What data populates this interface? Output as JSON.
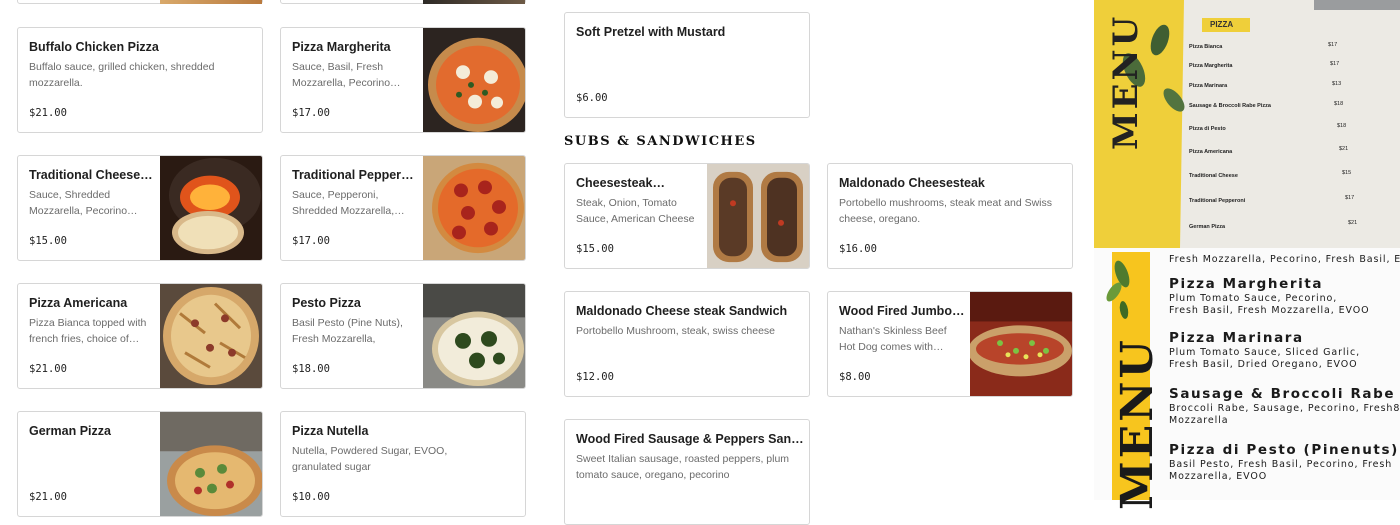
{
  "col1": [
    {
      "name": "Buffalo Chicken Pizza",
      "desc": "Buffalo sauce, grilled chicken, shredded mozzarella.",
      "price": "$21.00"
    },
    {
      "name": "Traditional Cheese…",
      "desc": "Sauce, Shredded Mozzarella, Pecorino…",
      "price": "$15.00"
    },
    {
      "name": "Pizza Americana",
      "desc": "Pizza Bianca topped with french fries, choice of…",
      "price": "$21.00"
    },
    {
      "name": "German Pizza",
      "desc": "",
      "price": "$21.00"
    }
  ],
  "col2": [
    {
      "name": "Pizza Margherita",
      "desc": "Sauce, Basil, Fresh Mozzarella, Pecorino…",
      "price": "$17.00"
    },
    {
      "name": "Traditional Pepperoni…",
      "desc": "Sauce, Pepperoni, Shredded Mozzarella,…",
      "price": "$17.00"
    },
    {
      "name": "Pesto Pizza",
      "desc": "Basil Pesto (Pine Nuts), Fresh Mozzarella, Pecori…",
      "price": "$18.00"
    },
    {
      "name": "Pizza Nutella",
      "desc": "Nutella, Powdered Sugar, EVOO, granulated sugar",
      "price": "$10.00"
    }
  ],
  "pretzel": {
    "name": "Soft Pretzel with Mustard",
    "desc": "",
    "price": "$6.00"
  },
  "section_title": "SUBS & SANDWICHES",
  "subs": [
    {
      "name": "Cheesesteak…",
      "desc": "Steak, Onion, Tomato Sauce, American Cheese",
      "price": "$15.00"
    },
    {
      "name": "Maldonado Cheesesteak",
      "desc": "Portobello mushrooms, steak meat and Swiss cheese, oregano.",
      "price": "$16.00"
    },
    {
      "name": "Maldonado Cheese steak Sandwich",
      "desc": "Portobello Mushroom, steak, swiss cheese",
      "price": "$12.00"
    },
    {
      "name": "Wood Fired Jumbo…",
      "desc": "Nathan's Skinless Beef Hot Dog comes with…",
      "price": "$8.00"
    },
    {
      "name": "Wood Fired Sausage & Peppers Sandwich",
      "desc": "Sweet Italian sausage, roasted peppers, plum tomato sauce, oregano, pecorino",
      "price": ""
    }
  ],
  "photo_menu": {
    "header": "PIZZA",
    "side_word": "MENU",
    "items": [
      {
        "name": "Pizza Bianca",
        "price": "$17"
      },
      {
        "name": "Pizza Margherita",
        "price": "$17"
      },
      {
        "name": "Pizza Marinara",
        "price": "$13"
      },
      {
        "name": "Sausage & Broccoli Rabe Pizza",
        "price": "$18"
      },
      {
        "name": "Pizza di Pesto",
        "price": "$18"
      },
      {
        "name": "Pizza Americana",
        "price": "$21"
      },
      {
        "name": "Traditional Cheese",
        "price": "$15"
      },
      {
        "name": "Traditional Pepperoni",
        "price": "$17"
      },
      {
        "name": "German Pizza",
        "price": "$21"
      }
    ]
  },
  "printed_menu": {
    "top_line": "Fresh Mozzarella, Pecorino, Fresh Basil, EVOO",
    "side_word": "MENU",
    "items": [
      {
        "title": "Pizza Margherita",
        "l1": "Plum Tomato Sauce, Pecorino,",
        "l2": "Fresh Basil, Fresh Mozzarella, EVOO"
      },
      {
        "title": "Pizza Marinara",
        "l1": "Plum Tomato Sauce, Sliced Garlic,",
        "l2": "Fresh Basil, Dried Oregano, EVOO"
      },
      {
        "title": "Sausage & Broccoli Rabe Pizza",
        "l1": "Broccoli Rabe, Sausage, Pecorino, Fresh8",
        "l2": "Mozzarella"
      },
      {
        "title": "Pizza di Pesto (Pinenuts)",
        "l1": "Basil Pesto, Fresh Basil, Pecorino, Fresh",
        "l2": "Mozzarella, EVOO"
      }
    ]
  }
}
